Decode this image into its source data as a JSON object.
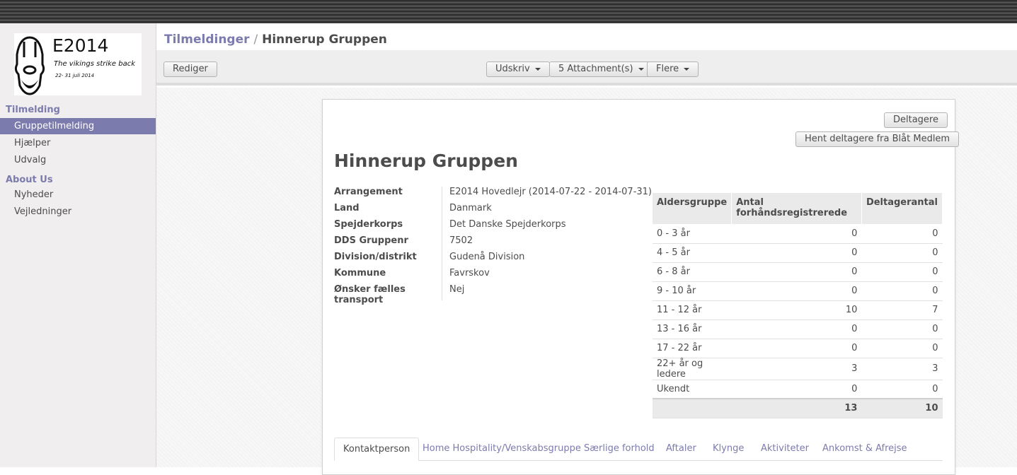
{
  "logo": {
    "text_main": "E2014",
    "tagline": "The vikings strike back",
    "dates": "22- 31 juli 2014"
  },
  "sidebar": {
    "sections": [
      {
        "title": "Tilmelding",
        "items": [
          {
            "label": "Gruppetilmelding",
            "active": true
          },
          {
            "label": "Hjælper"
          },
          {
            "label": "Udvalg"
          }
        ]
      },
      {
        "title": "About Us",
        "items": [
          {
            "label": "Nyheder"
          },
          {
            "label": "Vejledninger"
          }
        ]
      }
    ]
  },
  "breadcrumb": {
    "parent": "Tilmeldinger",
    "separator": "/",
    "current": "Hinnerup Gruppen"
  },
  "toolbar": {
    "edit_label": "Rediger",
    "print_label": "Udskriv",
    "attachments_label": "5 Attachment(s)",
    "more_label": "Flere"
  },
  "record": {
    "buttons": {
      "participants": "Deltagere",
      "fetch_participants": "Hent deltagere fra Blåt Medlem"
    },
    "title": "Hinnerup Gruppen",
    "fields": [
      {
        "label": "Arrangement",
        "value": "E2014 Hovedlejr (2014-07-22 - 2014-07-31)"
      },
      {
        "label": "Land",
        "value": "Danmark"
      },
      {
        "label": "Spejderkorps",
        "value": "Det Danske Spejderkorps"
      },
      {
        "label": "DDS Gruppenr",
        "value": "7502"
      },
      {
        "label": "Division/distrikt",
        "value": "Gudenå Division"
      },
      {
        "label": "Kommune",
        "value": "Favrskov"
      },
      {
        "label": "Ønsker fælles transport",
        "value": "Nej"
      }
    ],
    "age_table": {
      "headers": [
        "Aldersgruppe",
        "Antal forhåndsregistrerede",
        "Deltagerantal"
      ],
      "rows": [
        [
          "0 - 3 år",
          "0",
          "0"
        ],
        [
          "4 - 5 år",
          "0",
          "0"
        ],
        [
          "6 - 8 år",
          "0",
          "0"
        ],
        [
          "9 - 10 år",
          "0",
          "0"
        ],
        [
          "11 - 12 år",
          "10",
          "7"
        ],
        [
          "13 - 16 år",
          "0",
          "0"
        ],
        [
          "17 - 22 år",
          "0",
          "0"
        ],
        [
          "22+ år og ledere",
          "3",
          "3"
        ],
        [
          "Ukendt",
          "0",
          "0"
        ]
      ],
      "totals": [
        "",
        "13",
        "10"
      ]
    },
    "tabs": [
      {
        "label": "Kontaktperson",
        "active": true
      },
      {
        "label": "Home Hospitality/Venskabsgruppe"
      },
      {
        "label": "Særlige forhold"
      },
      {
        "label": "Aftaler"
      },
      {
        "label": "Klynge"
      },
      {
        "label": "Aktiviteter"
      },
      {
        "label": "Ankomst & Afrejse"
      }
    ]
  }
}
